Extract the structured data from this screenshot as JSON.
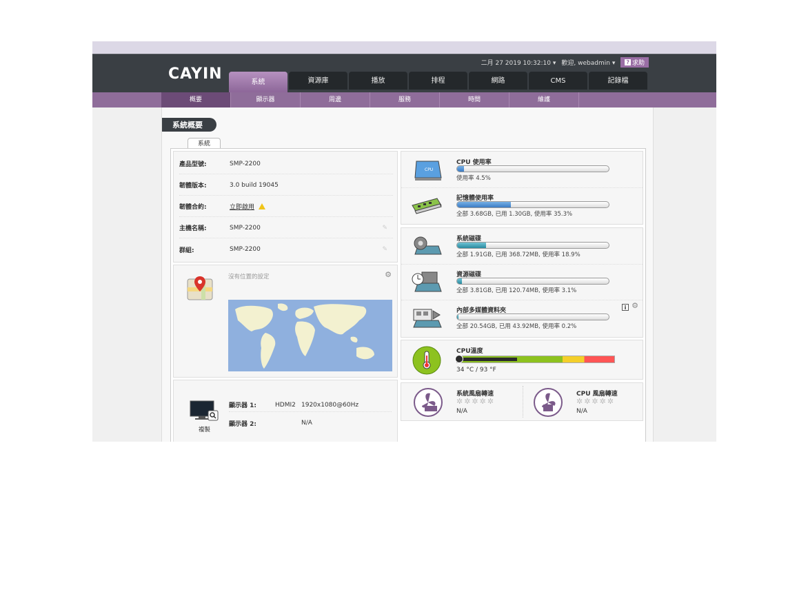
{
  "header": {
    "logo": "CAYIN",
    "datetime": "二月 27 2019 10:32:10",
    "welcome": "歡迎, webadmin",
    "help": "求助"
  },
  "tabs": [
    {
      "label": "系統"
    },
    {
      "label": "資源庫"
    },
    {
      "label": "播放"
    },
    {
      "label": "排程"
    },
    {
      "label": "網路"
    },
    {
      "label": "CMS"
    },
    {
      "label": "記錄檔"
    }
  ],
  "subnav": [
    {
      "label": "概要"
    },
    {
      "label": "顯示器"
    },
    {
      "label": "周邊"
    },
    {
      "label": "服務"
    },
    {
      "label": "時間"
    },
    {
      "label": "維護"
    }
  ],
  "page": {
    "title": "系統概要",
    "tab": "系統"
  },
  "info": [
    {
      "label": "產品型號:",
      "value": "SMP-2200"
    },
    {
      "label": "韌體版本:",
      "value": "3.0 build 19045"
    },
    {
      "label": "韌體合約:",
      "value": "立即啟用"
    },
    {
      "label": "主機名稱:",
      "value": "SMP-2200"
    },
    {
      "label": "群組:",
      "value": "SMP-2200"
    }
  ],
  "location": {
    "text": "沒有位置的設定"
  },
  "display": {
    "mode": "複製",
    "d1_label": "顯示器 1:",
    "d1_port": "HDMI2",
    "d1_res": "1920x1080@60Hz",
    "d2_label": "顯示器 2:",
    "d2_value": "N/A"
  },
  "cpu": {
    "title": "CPU 使用率",
    "text": "使用率 4.5%",
    "pct": 4.5
  },
  "memory": {
    "title": "記憶體使用率",
    "text": "全部 3.68GB, 已用 1.30GB, 使用率 35.3%",
    "pct": 35.3
  },
  "disks": [
    {
      "title": "系統磁碟",
      "text": "全部 1.91GB, 已用 368.72MB, 使用率 18.9%",
      "pct": 18.9
    },
    {
      "title": "資源磁碟",
      "text": "全部 3.81GB, 已用 120.74MB, 使用率 3.1%",
      "pct": 3.1
    },
    {
      "title": "內部多媒體資料夾",
      "text": "全部 20.54GB, 已用 43.92MB, 使用率 0.2%",
      "pct": 0.2
    }
  ],
  "temp": {
    "title": "CPU溫度",
    "text": "34 °C / 93 °F",
    "pct": 38
  },
  "fans": [
    {
      "title": "系統風扇轉速",
      "value": "N/A"
    },
    {
      "title": "CPU 風扇轉速",
      "value": "N/A"
    }
  ],
  "colors": {
    "accent": "#8f6d9a",
    "header": "#3a3f44",
    "bar": "#3b7bc4",
    "teal": "#2a8aa0"
  }
}
